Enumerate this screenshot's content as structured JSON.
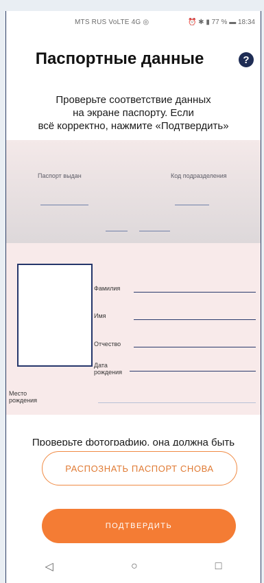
{
  "status_bar": {
    "left": "MTS RUS VoLTE 4G ◎",
    "right": "⏰ ✱ ▮ 77 % ▬ 18:34"
  },
  "header": {
    "title": "Паспортные данные",
    "help_label": "?"
  },
  "intro": {
    "line1": "Проверьте соответствие данных",
    "line2": "на экране паспорту. Если",
    "line3": "всё корректно, нажмите «Подтвердить»"
  },
  "passport_top": {
    "issued_label": "Паспорт выдан",
    "division_code_label": "Код подразделения"
  },
  "passport_bottom": {
    "surname_label": "Фамилия",
    "name_label": "Имя",
    "patronymic_label": "Отчество",
    "birth_date_label_1": "Дата",
    "birth_date_label_2": "рождения",
    "birth_place_label_1": "Место",
    "birth_place_label_2": "рождения"
  },
  "photo_hint_cutoff": "Проверьте фотографию, она должна быть",
  "buttons": {
    "rescan": "РАСПОЗНАТЬ ПАСПОРТ СНОВА",
    "confirm": "ПОДТВЕРДИТЬ"
  },
  "nav": {
    "back": "◁",
    "home": "○",
    "recents": "□"
  },
  "colors": {
    "accent": "#f47c34",
    "navy": "#24356a"
  }
}
